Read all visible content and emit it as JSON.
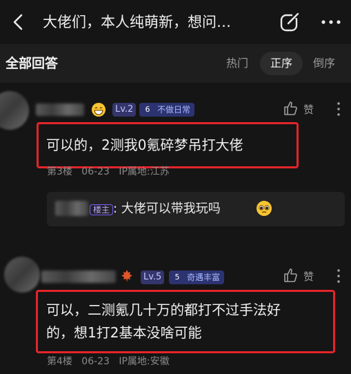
{
  "header": {
    "title": "大佬们，本人纯萌新，想问…",
    "icons": {
      "back": "back-icon",
      "share": "share-icon",
      "more": "more-icon"
    }
  },
  "section": {
    "title": "全部回答",
    "tabs": [
      {
        "label": "热门",
        "active": false
      },
      {
        "label": "正序",
        "active": true
      },
      {
        "label": "倒序",
        "active": false
      }
    ]
  },
  "answers": [
    {
      "level": "Lv.2",
      "badge_num": "6",
      "badge": "不做日常",
      "like": "赞",
      "content": "可以的，2测我0氪碎梦吊打大佬",
      "floor": "第3楼",
      "date": "06-23",
      "ip": "IP属地:江苏",
      "reply": {
        "host_tag": "楼主",
        "text": ": 大佬可以带我玩吗"
      }
    },
    {
      "level": "Lv.5",
      "badge_num": "5",
      "badge": "奇遇丰富",
      "like": "赞",
      "content_line1": "可以，二测氪几十万的都打不过手法好",
      "content_line2": "的，想1打2基本没啥可能",
      "floor": "第4楼",
      "date": "06-23",
      "ip": "IP属地:安徽"
    }
  ],
  "colors": {
    "background": "#151515",
    "highlight_box": "#e4242a",
    "level_badge": "#34356a"
  }
}
